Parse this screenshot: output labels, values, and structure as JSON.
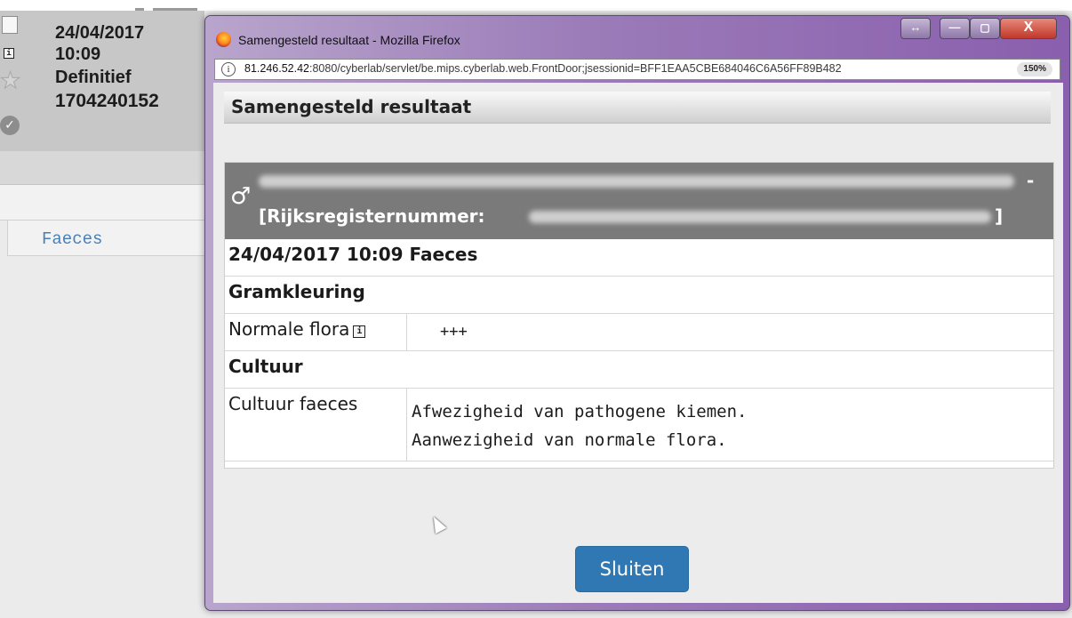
{
  "background": {
    "record": {
      "date": "24/04/2017",
      "time": "10:09",
      "status": "Definitief",
      "number": "1704240152"
    },
    "list_item": "Faeces"
  },
  "window": {
    "title": "Samengesteld resultaat - Mozilla Firefox",
    "url_host": "81.246.52.42",
    "url_rest": ":8080/cyberlab/servlet/be.mips.cyberlab.web.FrontDoor;jsessionid=BFF1EAA5CBE684046C6A56FF89B482",
    "zoom": "150%",
    "buttons": {
      "resize": "↔",
      "minimize": "—",
      "maximize": "▢",
      "close": "X"
    }
  },
  "dialog": {
    "title": "Samengesteld resultaat",
    "patient": {
      "gender_icon": "male-icon",
      "separator": "-",
      "rr_label": "[Rijksregisternummer:",
      "rr_end": "]"
    },
    "sample_header": "24/04/2017 10:09 Faeces",
    "sections": [
      {
        "title": "Gramkleuring",
        "rows": [
          {
            "label": "Normale flora",
            "value": "+++"
          }
        ]
      },
      {
        "title": "Cultuur",
        "rows": [
          {
            "label": "Cultuur faeces",
            "value_lines": [
              "Afwezigheid van pathogene kiemen.",
              "Aanwezigheid van normale flora."
            ]
          }
        ]
      }
    ],
    "close_button": "Sluiten"
  }
}
